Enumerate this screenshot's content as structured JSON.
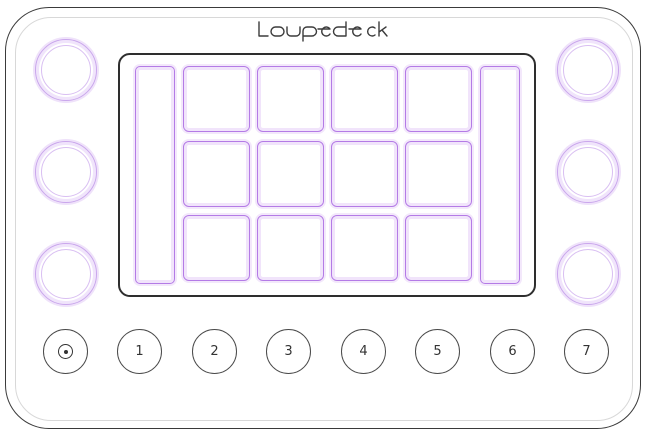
{
  "device": {
    "brand": "Loupedeck",
    "accent_color": "#b47be6",
    "knobs_left": [
      "knob",
      "knob",
      "knob"
    ],
    "knobs_right": [
      "knob",
      "knob",
      "knob"
    ],
    "screen_keys": {
      "rows": 3,
      "columns": 4,
      "side_bars": [
        "left-bar",
        "right-bar"
      ]
    },
    "round_buttons": [
      {
        "label": "",
        "icon": "circle-dot-icon"
      },
      {
        "label": "1"
      },
      {
        "label": "2"
      },
      {
        "label": "3"
      },
      {
        "label": "4"
      },
      {
        "label": "5"
      },
      {
        "label": "6"
      },
      {
        "label": "7"
      }
    ]
  }
}
